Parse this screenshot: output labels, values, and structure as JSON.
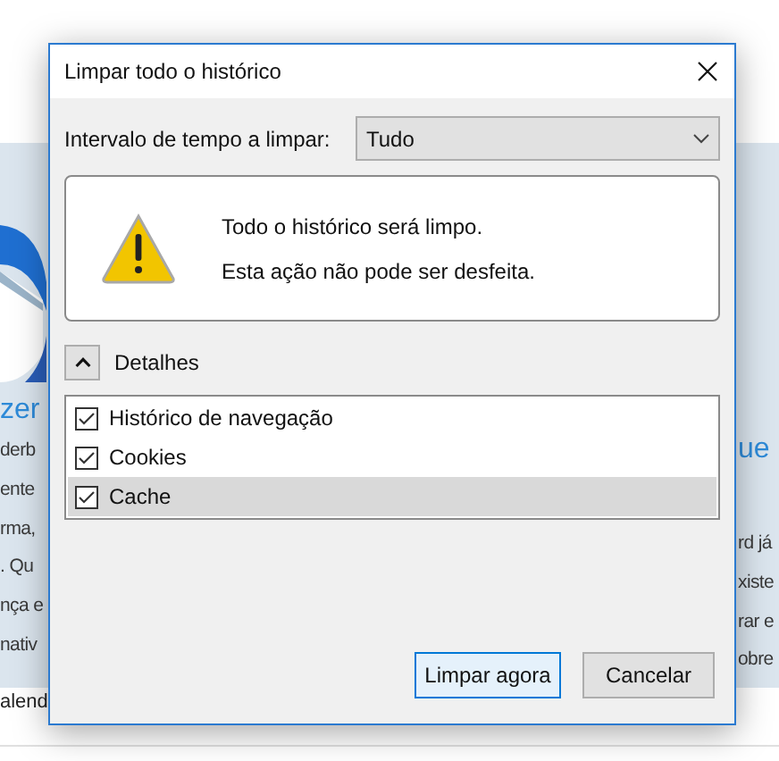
{
  "background": {
    "left_fragments": [
      {
        "text": "zer",
        "kind": "heading"
      },
      {
        "text": "derb",
        "kind": "line"
      },
      {
        "text": "ente",
        "kind": "line"
      },
      {
        "text": "rma,",
        "kind": "line"
      },
      {
        "text": ". Qu",
        "kind": "line"
      },
      {
        "text": "nça e",
        "kind": "line"
      },
      {
        "text": "nativ",
        "kind": "line"
      }
    ],
    "right_fragments": [
      {
        "text": "ue",
        "kind": "heading"
      },
      {
        "text": "rd já",
        "kind": "line"
      },
      {
        "text": "xiste",
        "kind": "line"
      },
      {
        "text": "rar e",
        "kind": "line"
      },
      {
        "text": "obre",
        "kind": "line"
      }
    ],
    "footer_fragment": "alend"
  },
  "dialog": {
    "title": "Limpar todo o histórico",
    "time_range": {
      "label": "Intervalo de tempo a limpar:",
      "value": "Tudo"
    },
    "warning": [
      "Todo o histórico será limpo.",
      "Esta ação não pode ser desfeita."
    ],
    "details": {
      "label": "Detalhes",
      "expanded": true
    },
    "items": [
      {
        "label": "Histórico de navegação",
        "checked": true,
        "selected": false
      },
      {
        "label": "Cookies",
        "checked": true,
        "selected": false
      },
      {
        "label": "Cache",
        "checked": true,
        "selected": true
      }
    ],
    "buttons": [
      {
        "label": "Limpar agora",
        "default": true
      },
      {
        "label": "Cancelar",
        "default": false
      }
    ]
  }
}
